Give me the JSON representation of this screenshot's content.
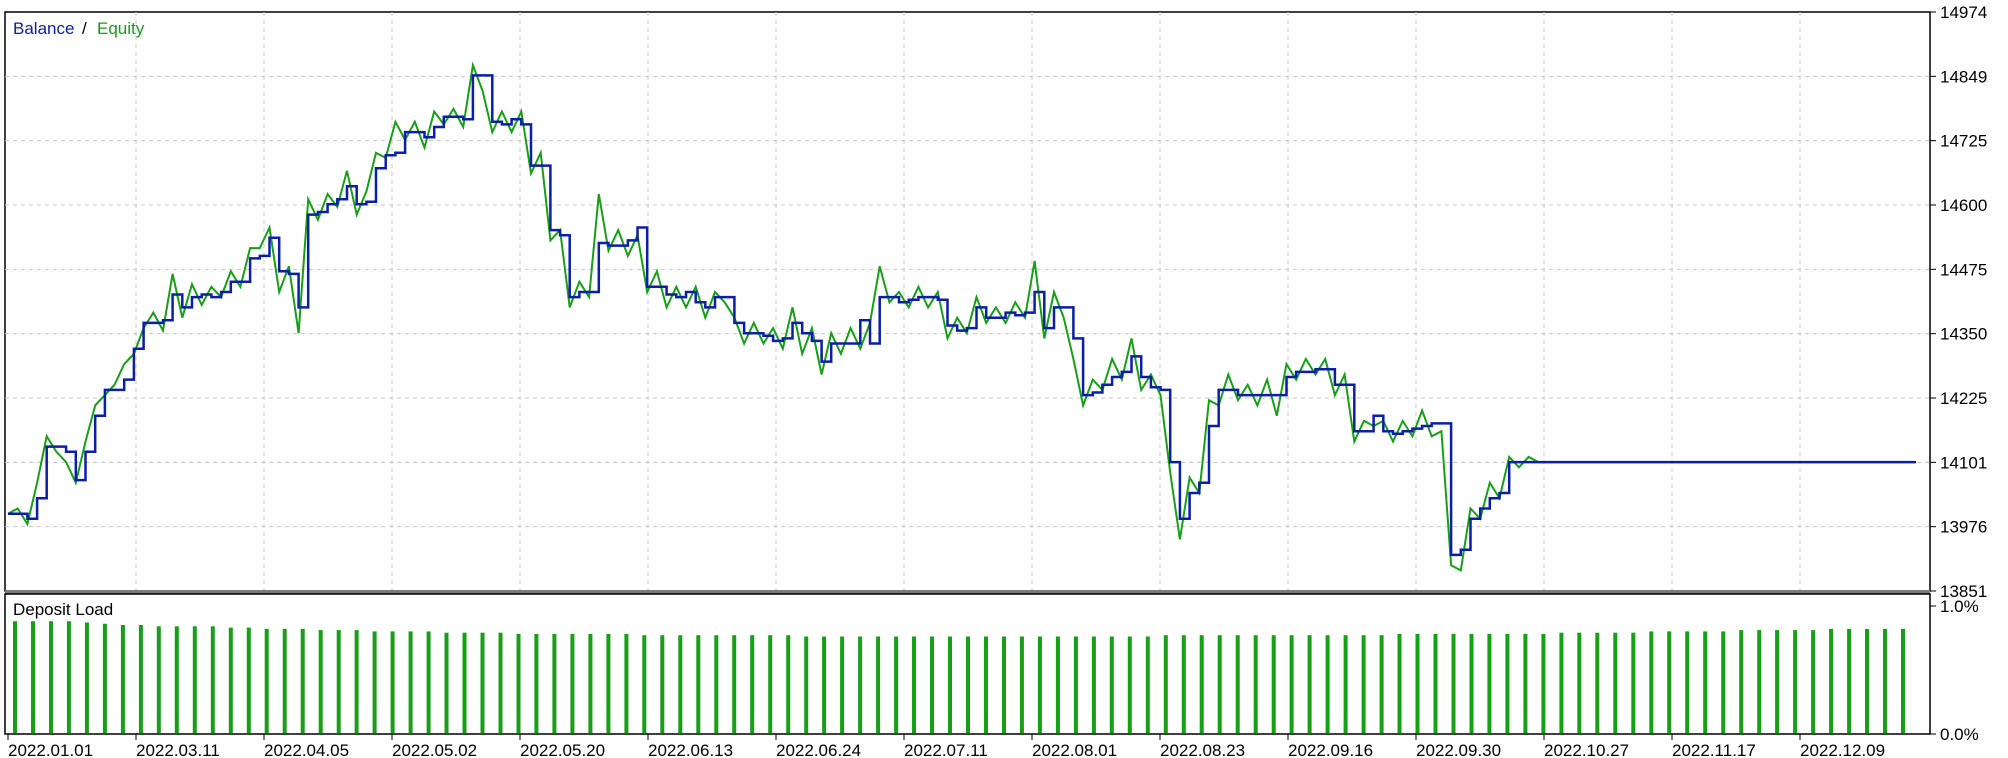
{
  "colors": {
    "balance": "#0a1fa8",
    "equity": "#16a016",
    "grid": "#c8c8c8",
    "frame": "#000000",
    "axis_text": "#000000",
    "deposit_bar": "#16a016"
  },
  "legend": {
    "balance_label": "Balance",
    "separator": " / ",
    "equity_label": "Equity"
  },
  "deposit": {
    "label": "Deposit Load"
  },
  "chart_data": [
    {
      "type": "line",
      "title": "",
      "xlabel": "",
      "ylabel": "",
      "legend_position": "top-left",
      "grid": true,
      "ylim": [
        13851,
        14974
      ],
      "ytick_labels": [
        "14974",
        "14849",
        "14725",
        "14600",
        "14475",
        "14350",
        "14225",
        "14101",
        "13976",
        "13851"
      ],
      "x_tick_labels": [
        "2022.01.01",
        "2022.03.11",
        "2022.04.05",
        "2022.05.02",
        "2022.05.20",
        "2022.06.13",
        "2022.06.24",
        "2022.07.11",
        "2022.08.01",
        "2022.08.23",
        "2022.09.16",
        "2022.09.30",
        "2022.10.27",
        "2022.11.17",
        "2022.12.09"
      ],
      "series": [
        {
          "name": "Balance",
          "x": [
            0,
            3,
            6,
            9,
            12,
            15,
            18,
            21,
            24,
            27,
            30,
            33,
            36,
            39,
            42,
            45,
            48,
            51,
            54,
            57,
            60,
            63,
            66,
            69,
            72,
            75,
            78,
            81,
            84,
            87,
            90,
            93,
            96,
            99,
            102,
            105,
            108,
            111,
            114,
            117,
            120,
            123,
            126,
            129,
            132,
            135,
            138,
            141,
            144,
            147,
            150,
            153,
            156,
            159,
            162,
            165,
            168,
            171,
            174,
            177,
            180,
            183,
            186,
            189,
            192,
            195,
            198,
            201,
            204,
            207,
            210,
            213,
            216,
            219,
            222,
            225,
            228,
            231,
            234,
            237,
            240,
            243,
            246,
            249,
            252,
            255,
            258,
            261,
            264,
            267,
            270,
            273,
            276,
            279,
            282,
            285,
            288,
            291,
            294,
            297,
            300,
            303,
            306,
            309,
            312,
            315,
            318,
            321,
            324,
            327,
            330,
            333,
            336,
            339,
            342,
            345,
            348,
            351,
            354,
            357,
            360,
            363,
            366,
            369,
            372,
            375,
            378,
            381,
            384,
            387,
            390,
            393,
            396,
            399,
            402,
            405,
            408,
            411,
            414,
            417,
            420,
            423,
            426,
            429,
            432,
            435,
            438,
            441,
            444,
            447,
            450,
            453,
            456,
            459,
            462,
            465,
            468,
            471,
            474,
            477,
            480,
            483,
            486,
            489,
            492,
            495,
            498,
            501,
            504,
            507,
            510,
            513,
            516,
            519,
            522,
            525,
            528,
            531,
            534,
            537,
            540,
            543,
            546,
            549,
            552,
            555,
            558,
            561,
            564,
            567,
            570,
            573,
            576,
            579,
            582,
            585,
            588,
            591
          ],
          "values": [
            14001,
            14001,
            13991,
            14031,
            14131,
            14131,
            14121,
            14066,
            14121,
            14191,
            14241,
            14241,
            14261,
            14321,
            14371,
            14371,
            14376,
            14426,
            14401,
            14421,
            14426,
            14421,
            14431,
            14451,
            14451,
            14496,
            14501,
            14536,
            14471,
            14466,
            14401,
            14581,
            14586,
            14601,
            14611,
            14636,
            14601,
            14606,
            14671,
            14696,
            14701,
            14741,
            14741,
            14731,
            14751,
            14771,
            14771,
            14766,
            14851,
            14851,
            14761,
            14756,
            14766,
            14756,
            14676,
            14676,
            14551,
            14541,
            14421,
            14431,
            14431,
            14526,
            14521,
            14521,
            14531,
            14556,
            14441,
            14441,
            14426,
            14421,
            14431,
            14411,
            14401,
            14421,
            14421,
            14371,
            14351,
            14351,
            14346,
            14336,
            14341,
            14371,
            14351,
            14336,
            14296,
            14331,
            14331,
            14331,
            14376,
            14331,
            14421,
            14421,
            14411,
            14416,
            14421,
            14421,
            14416,
            14366,
            14356,
            14361,
            14401,
            14381,
            14381,
            14391,
            14386,
            14391,
            14431,
            14361,
            14401,
            14401,
            14341,
            14231,
            14236,
            14251,
            14266,
            14276,
            14306,
            14266,
            14246,
            14241,
            14101,
            13991,
            14041,
            14061,
            14171,
            14241,
            14241,
            14231,
            14231,
            14231,
            14231,
            14231,
            14266,
            14276,
            14276,
            14281,
            14281,
            14251,
            14251,
            14161,
            14161,
            14191,
            14161,
            14156,
            14161,
            14166,
            14171,
            14176,
            14176,
            13921,
            13931,
            13991,
            14011,
            14031,
            14041,
            14101,
            14101,
            14101,
            14101,
            14101,
            14101,
            14101,
            14101,
            14101,
            14101,
            14101,
            14101,
            14101,
            14101,
            14101,
            14101,
            14101,
            14101,
            14101,
            14101,
            14101,
            14101,
            14101,
            14101,
            14101,
            14101,
            14101,
            14101,
            14101,
            14101,
            14101,
            14101,
            14101,
            14101,
            14101,
            14101,
            14101,
            14101,
            14101,
            14101,
            14101,
            14101,
            14101
          ]
        },
        {
          "name": "Equity",
          "x": [
            0,
            3,
            6,
            9,
            12,
            15,
            18,
            21,
            24,
            27,
            30,
            33,
            36,
            39,
            42,
            45,
            48,
            51,
            54,
            57,
            60,
            63,
            66,
            69,
            72,
            75,
            78,
            81,
            84,
            87,
            90,
            93,
            96,
            99,
            102,
            105,
            108,
            111,
            114,
            117,
            120,
            123,
            126,
            129,
            132,
            135,
            138,
            141,
            144,
            147,
            150,
            153,
            156,
            159,
            162,
            165,
            168,
            171,
            174,
            177,
            180,
            183,
            186,
            189,
            192,
            195,
            198,
            201,
            204,
            207,
            210,
            213,
            216,
            219,
            222,
            225,
            228,
            231,
            234,
            237,
            240,
            243,
            246,
            249,
            252,
            255,
            258,
            261,
            264,
            267,
            270,
            273,
            276,
            279,
            282,
            285,
            288,
            291,
            294,
            297,
            300,
            303,
            306,
            309,
            312,
            315,
            318,
            321,
            324,
            327,
            330,
            333,
            336,
            339,
            342,
            345,
            348,
            351,
            354,
            357,
            360,
            363,
            366,
            369,
            372,
            375,
            378,
            381,
            384,
            387,
            390,
            393,
            396,
            399,
            402,
            405,
            408,
            411,
            414,
            417,
            420,
            423,
            426,
            429,
            432,
            435,
            438,
            441,
            444,
            447,
            450,
            453,
            456,
            459,
            462,
            465,
            468,
            471,
            474,
            477,
            480,
            483,
            486,
            489,
            492,
            495,
            498,
            501,
            504,
            507,
            510,
            513,
            516,
            519,
            522,
            525,
            528,
            531,
            534,
            537,
            540,
            543,
            546,
            549,
            552,
            555,
            558,
            561,
            564,
            567,
            570,
            573,
            576,
            579,
            582,
            585,
            588,
            591
          ],
          "values": [
            14001,
            14011,
            13981,
            14061,
            14151,
            14121,
            14101,
            14061,
            14141,
            14211,
            14231,
            14251,
            14291,
            14311,
            14361,
            14391,
            14356,
            14466,
            14381,
            14446,
            14406,
            14441,
            14421,
            14471,
            14441,
            14516,
            14516,
            14556,
            14431,
            14481,
            14351,
            14611,
            14571,
            14621,
            14596,
            14666,
            14581,
            14626,
            14701,
            14691,
            14761,
            14726,
            14761,
            14711,
            14781,
            14756,
            14786,
            14751,
            14871,
            14821,
            14741,
            14781,
            14741,
            14781,
            14661,
            14701,
            14531,
            14551,
            14401,
            14451,
            14421,
            14621,
            14511,
            14551,
            14501,
            14541,
            14431,
            14471,
            14401,
            14441,
            14401,
            14441,
            14381,
            14431,
            14411,
            14381,
            14331,
            14371,
            14331,
            14361,
            14321,
            14401,
            14311,
            14361,
            14271,
            14351,
            14311,
            14361,
            14321,
            14371,
            14481,
            14411,
            14431,
            14401,
            14441,
            14401,
            14431,
            14341,
            14381,
            14351,
            14421,
            14371,
            14401,
            14371,
            14411,
            14381,
            14491,
            14341,
            14431,
            14381,
            14301,
            14211,
            14261,
            14241,
            14301,
            14261,
            14341,
            14241,
            14271,
            14231,
            14081,
            13951,
            14071,
            14041,
            14221,
            14211,
            14271,
            14221,
            14251,
            14211,
            14261,
            14191,
            14291,
            14261,
            14301,
            14271,
            14301,
            14231,
            14271,
            14141,
            14181,
            14171,
            14181,
            14141,
            14181,
            14151,
            14201,
            14151,
            14161,
            13901,
            13891,
            14011,
            13991,
            14061,
            14031,
            14111,
            14091,
            14111,
            14101,
            14101,
            14101,
            14101,
            14101,
            14101,
            14101,
            14101,
            14101,
            14101,
            14101,
            14101,
            14101,
            14101,
            14101,
            14101,
            14101,
            14101,
            14101,
            14101,
            14101,
            14101,
            14101,
            14101,
            14101,
            14101,
            14101,
            14101,
            14101,
            14101,
            14101,
            14101,
            14101,
            14101,
            14101,
            14101,
            14101,
            14101,
            14101,
            14101
          ]
        }
      ]
    },
    {
      "type": "bar",
      "title": "Deposit Load",
      "ylim": [
        0,
        1.0
      ],
      "ytick_labels": [
        "1.0%",
        "0.0%"
      ],
      "values": [
        0.88,
        0.88,
        0.88,
        0.88,
        0.87,
        0.86,
        0.85,
        0.85,
        0.84,
        0.84,
        0.84,
        0.84,
        0.83,
        0.83,
        0.82,
        0.82,
        0.82,
        0.81,
        0.81,
        0.81,
        0.8,
        0.8,
        0.8,
        0.8,
        0.79,
        0.79,
        0.79,
        0.79,
        0.78,
        0.78,
        0.78,
        0.78,
        0.78,
        0.78,
        0.78,
        0.77,
        0.77,
        0.77,
        0.77,
        0.77,
        0.77,
        0.77,
        0.77,
        0.77,
        0.76,
        0.76,
        0.76,
        0.76,
        0.76,
        0.76,
        0.76,
        0.76,
        0.76,
        0.76,
        0.76,
        0.76,
        0.76,
        0.76,
        0.76,
        0.76,
        0.76,
        0.76,
        0.76,
        0.76,
        0.77,
        0.77,
        0.77,
        0.77,
        0.77,
        0.77,
        0.77,
        0.77,
        0.77,
        0.77,
        0.77,
        0.77,
        0.77,
        0.78,
        0.78,
        0.78,
        0.78,
        0.78,
        0.78,
        0.78,
        0.78,
        0.78,
        0.79,
        0.79,
        0.79,
        0.79,
        0.79,
        0.8,
        0.8,
        0.8,
        0.8,
        0.8,
        0.81,
        0.81,
        0.81,
        0.81,
        0.81,
        0.82,
        0.82,
        0.82,
        0.82,
        0.82
      ]
    }
  ]
}
